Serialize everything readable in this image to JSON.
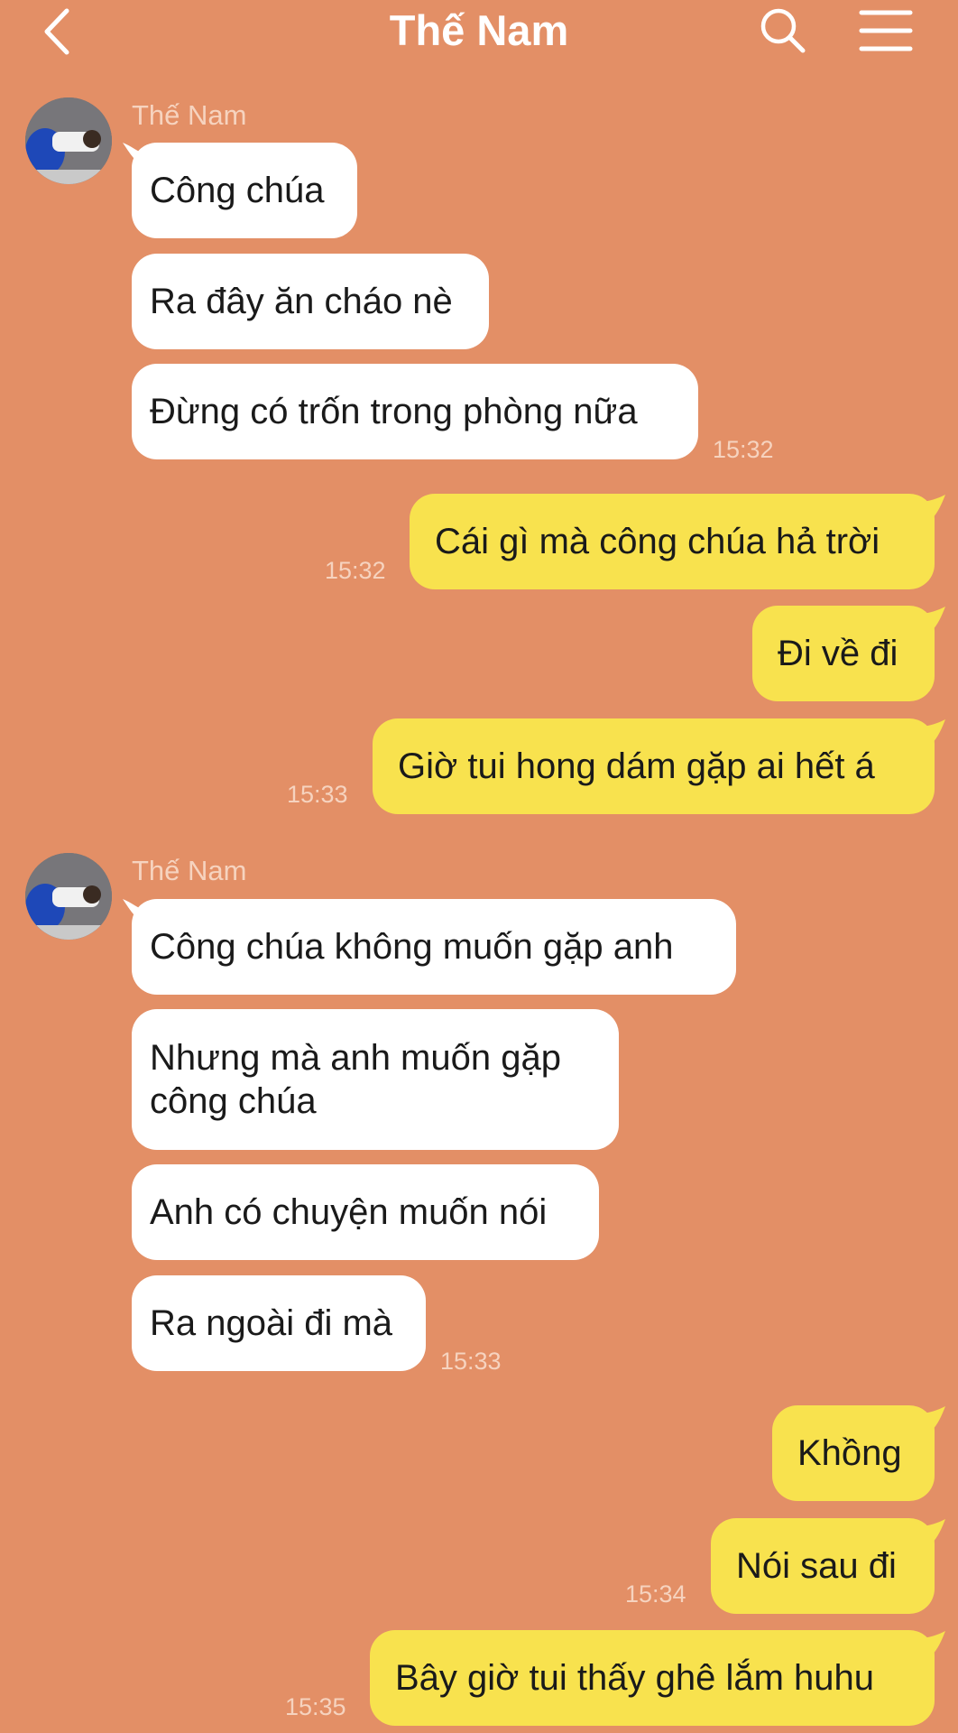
{
  "header": {
    "title": "Thế Nam"
  },
  "messages": [
    {
      "sender": "Thế Nam",
      "text": "Công chúa"
    },
    {
      "text": "Ra đây ăn cháo nè"
    },
    {
      "text": "Đừng có trốn trong phòng nữa",
      "time": "15:32"
    },
    {
      "text": "Cái gì mà công chúa hả trời",
      "time": "15:32"
    },
    {
      "text": "Đi về đi"
    },
    {
      "text": "Giờ tui hong dám gặp ai hết á",
      "time": "15:33"
    },
    {
      "sender": "Thế Nam",
      "text": "Công chúa không muốn gặp anh"
    },
    {
      "text_line1": "Nhưng mà anh muốn gặp",
      "text_line2": "công chúa"
    },
    {
      "text": "Anh có chuyện muốn nói"
    },
    {
      "text": "Ra ngoài đi mà",
      "time": "15:33"
    },
    {
      "text": "Khồng"
    },
    {
      "text": "Nói sau đi",
      "time": "15:34"
    },
    {
      "text": "Bây giờ tui thấy ghê lắm huhu",
      "time": "15:35"
    }
  ],
  "colors": {
    "background": "#E38F66",
    "incoming_bubble": "#FFFFFF",
    "outgoing_bubble": "#F8E24E",
    "meta_text": "#F6D3BF"
  },
  "icons": {
    "back": "chevron-left-icon",
    "search": "search-icon",
    "menu": "hamburger-menu-icon"
  }
}
